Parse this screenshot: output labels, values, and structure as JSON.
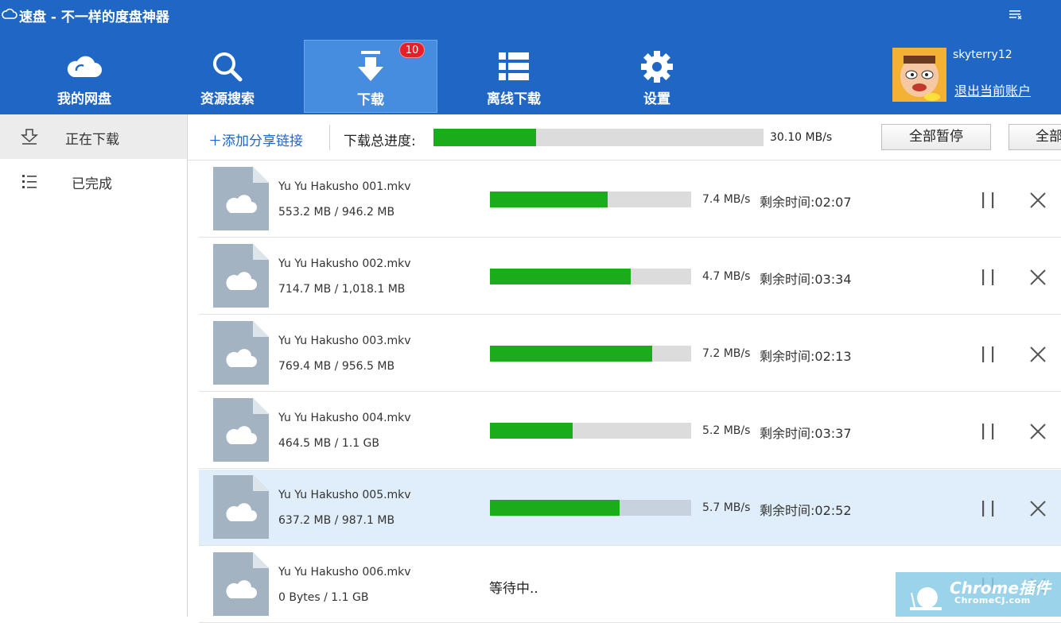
{
  "app": {
    "title": "速盘 - 不一样的度盘神器"
  },
  "nav": [
    {
      "label": "我的网盘",
      "icon": "cloud-icon"
    },
    {
      "label": "资源搜索",
      "icon": "search-icon"
    },
    {
      "label": "下载",
      "icon": "download-icon",
      "active": true,
      "badge": "10"
    },
    {
      "label": "离线下载",
      "icon": "list-icon"
    },
    {
      "label": "设置",
      "icon": "gear-icon"
    }
  ],
  "user": {
    "name": "skyterry12",
    "logout": "退出当前账户"
  },
  "sidebar": {
    "items": [
      {
        "label": "正在下载",
        "icon": "download-tray-icon",
        "active": true
      },
      {
        "label": "已完成",
        "icon": "list-bullet-icon"
      }
    ]
  },
  "toolbar": {
    "add_link": "＋添加分享链接",
    "total_label": "下载总进度:",
    "total_progress": 0.31,
    "total_speed": "30.10 MB/s",
    "pause_all": "全部暂停",
    "all_second": "全部"
  },
  "downloads": [
    {
      "name": "Yu Yu Hakusho 001.mkv",
      "size": "553.2 MB / 946.2 MB",
      "progress": 0.585,
      "speed": "7.4 MB/s",
      "remaining": "剩余时间:02:07"
    },
    {
      "name": "Yu Yu Hakusho 002.mkv",
      "size": "714.7 MB / 1,018.1 MB",
      "progress": 0.7,
      "speed": "4.7 MB/s",
      "remaining": "剩余时间:03:34"
    },
    {
      "name": "Yu Yu Hakusho 003.mkv",
      "size": "769.4 MB / 956.5 MB",
      "progress": 0.805,
      "speed": "7.2 MB/s",
      "remaining": "剩余时间:02:13"
    },
    {
      "name": "Yu Yu Hakusho 004.mkv",
      "size": "464.5 MB / 1.1 GB",
      "progress": 0.41,
      "speed": "5.2 MB/s",
      "remaining": "剩余时间:03:37"
    },
    {
      "name": "Yu Yu Hakusho 005.mkv",
      "size": "637.2 MB / 987.1 MB",
      "progress": 0.645,
      "speed": "5.7 MB/s",
      "remaining": "剩余时间:02:52",
      "selected": true
    },
    {
      "name": "Yu Yu Hakusho 006.mkv",
      "size": "0 Bytes / 1.1 GB",
      "status": "等待中.."
    }
  ],
  "watermark": {
    "line1": "Chrome插件",
    "line2": "ChromeCJ.com"
  },
  "colors": {
    "header": "#2067c5",
    "active_nav": "#468de0",
    "progress": "#1aac1a",
    "badge": "#e5202b"
  }
}
